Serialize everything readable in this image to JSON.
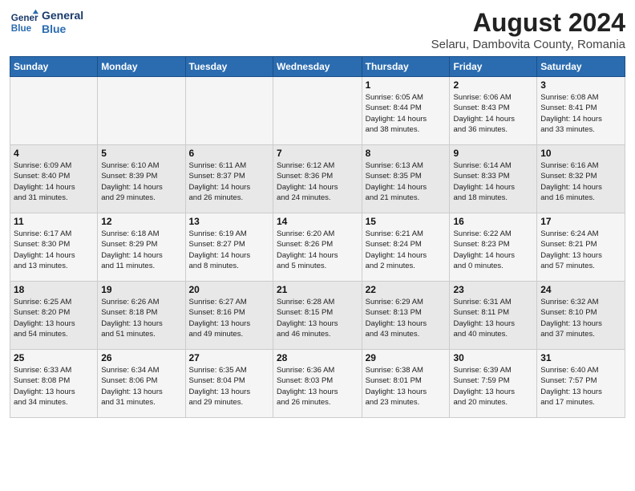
{
  "logo": {
    "line1": "General",
    "line2": "Blue"
  },
  "title": "August 2024",
  "subtitle": "Selaru, Dambovita County, Romania",
  "weekdays": [
    "Sunday",
    "Monday",
    "Tuesday",
    "Wednesday",
    "Thursday",
    "Friday",
    "Saturday"
  ],
  "weeks": [
    [
      {
        "day": "",
        "info": ""
      },
      {
        "day": "",
        "info": ""
      },
      {
        "day": "",
        "info": ""
      },
      {
        "day": "",
        "info": ""
      },
      {
        "day": "1",
        "info": "Sunrise: 6:05 AM\nSunset: 8:44 PM\nDaylight: 14 hours\nand 38 minutes."
      },
      {
        "day": "2",
        "info": "Sunrise: 6:06 AM\nSunset: 8:43 PM\nDaylight: 14 hours\nand 36 minutes."
      },
      {
        "day": "3",
        "info": "Sunrise: 6:08 AM\nSunset: 8:41 PM\nDaylight: 14 hours\nand 33 minutes."
      }
    ],
    [
      {
        "day": "4",
        "info": "Sunrise: 6:09 AM\nSunset: 8:40 PM\nDaylight: 14 hours\nand 31 minutes."
      },
      {
        "day": "5",
        "info": "Sunrise: 6:10 AM\nSunset: 8:39 PM\nDaylight: 14 hours\nand 29 minutes."
      },
      {
        "day": "6",
        "info": "Sunrise: 6:11 AM\nSunset: 8:37 PM\nDaylight: 14 hours\nand 26 minutes."
      },
      {
        "day": "7",
        "info": "Sunrise: 6:12 AM\nSunset: 8:36 PM\nDaylight: 14 hours\nand 24 minutes."
      },
      {
        "day": "8",
        "info": "Sunrise: 6:13 AM\nSunset: 8:35 PM\nDaylight: 14 hours\nand 21 minutes."
      },
      {
        "day": "9",
        "info": "Sunrise: 6:14 AM\nSunset: 8:33 PM\nDaylight: 14 hours\nand 18 minutes."
      },
      {
        "day": "10",
        "info": "Sunrise: 6:16 AM\nSunset: 8:32 PM\nDaylight: 14 hours\nand 16 minutes."
      }
    ],
    [
      {
        "day": "11",
        "info": "Sunrise: 6:17 AM\nSunset: 8:30 PM\nDaylight: 14 hours\nand 13 minutes."
      },
      {
        "day": "12",
        "info": "Sunrise: 6:18 AM\nSunset: 8:29 PM\nDaylight: 14 hours\nand 11 minutes."
      },
      {
        "day": "13",
        "info": "Sunrise: 6:19 AM\nSunset: 8:27 PM\nDaylight: 14 hours\nand 8 minutes."
      },
      {
        "day": "14",
        "info": "Sunrise: 6:20 AM\nSunset: 8:26 PM\nDaylight: 14 hours\nand 5 minutes."
      },
      {
        "day": "15",
        "info": "Sunrise: 6:21 AM\nSunset: 8:24 PM\nDaylight: 14 hours\nand 2 minutes."
      },
      {
        "day": "16",
        "info": "Sunrise: 6:22 AM\nSunset: 8:23 PM\nDaylight: 14 hours\nand 0 minutes."
      },
      {
        "day": "17",
        "info": "Sunrise: 6:24 AM\nSunset: 8:21 PM\nDaylight: 13 hours\nand 57 minutes."
      }
    ],
    [
      {
        "day": "18",
        "info": "Sunrise: 6:25 AM\nSunset: 8:20 PM\nDaylight: 13 hours\nand 54 minutes."
      },
      {
        "day": "19",
        "info": "Sunrise: 6:26 AM\nSunset: 8:18 PM\nDaylight: 13 hours\nand 51 minutes."
      },
      {
        "day": "20",
        "info": "Sunrise: 6:27 AM\nSunset: 8:16 PM\nDaylight: 13 hours\nand 49 minutes."
      },
      {
        "day": "21",
        "info": "Sunrise: 6:28 AM\nSunset: 8:15 PM\nDaylight: 13 hours\nand 46 minutes."
      },
      {
        "day": "22",
        "info": "Sunrise: 6:29 AM\nSunset: 8:13 PM\nDaylight: 13 hours\nand 43 minutes."
      },
      {
        "day": "23",
        "info": "Sunrise: 6:31 AM\nSunset: 8:11 PM\nDaylight: 13 hours\nand 40 minutes."
      },
      {
        "day": "24",
        "info": "Sunrise: 6:32 AM\nSunset: 8:10 PM\nDaylight: 13 hours\nand 37 minutes."
      }
    ],
    [
      {
        "day": "25",
        "info": "Sunrise: 6:33 AM\nSunset: 8:08 PM\nDaylight: 13 hours\nand 34 minutes."
      },
      {
        "day": "26",
        "info": "Sunrise: 6:34 AM\nSunset: 8:06 PM\nDaylight: 13 hours\nand 31 minutes."
      },
      {
        "day": "27",
        "info": "Sunrise: 6:35 AM\nSunset: 8:04 PM\nDaylight: 13 hours\nand 29 minutes."
      },
      {
        "day": "28",
        "info": "Sunrise: 6:36 AM\nSunset: 8:03 PM\nDaylight: 13 hours\nand 26 minutes."
      },
      {
        "day": "29",
        "info": "Sunrise: 6:38 AM\nSunset: 8:01 PM\nDaylight: 13 hours\nand 23 minutes."
      },
      {
        "day": "30",
        "info": "Sunrise: 6:39 AM\nSunset: 7:59 PM\nDaylight: 13 hours\nand 20 minutes."
      },
      {
        "day": "31",
        "info": "Sunrise: 6:40 AM\nSunset: 7:57 PM\nDaylight: 13 hours\nand 17 minutes."
      }
    ]
  ]
}
